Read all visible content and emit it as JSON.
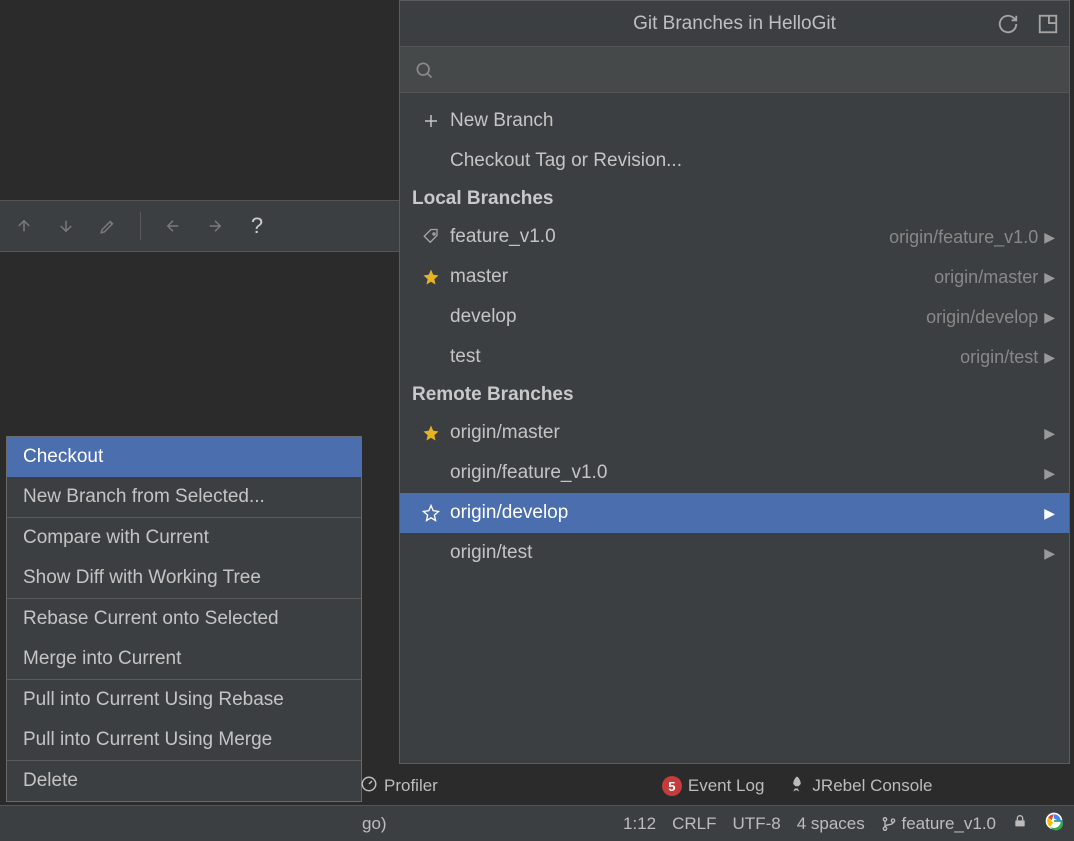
{
  "popup": {
    "title": "Git Branches in HelloGit",
    "new_branch_label": "New Branch",
    "checkout_tag_label": "Checkout Tag or Revision...",
    "local_header": "Local Branches",
    "remote_header": "Remote Branches",
    "local_branches": [
      {
        "name": "feature_v1.0",
        "icon": "tag",
        "tracking": "origin/feature_v1.0"
      },
      {
        "name": "master",
        "icon": "star-filled",
        "tracking": "origin/master"
      },
      {
        "name": "develop",
        "icon": "",
        "tracking": "origin/develop"
      },
      {
        "name": "test",
        "icon": "",
        "tracking": "origin/test"
      }
    ],
    "remote_branches": [
      {
        "name": "origin/master",
        "icon": "star-filled",
        "selected": false
      },
      {
        "name": "origin/feature_v1.0",
        "icon": "",
        "selected": false
      },
      {
        "name": "origin/develop",
        "icon": "star-outline",
        "selected": true
      },
      {
        "name": "origin/test",
        "icon": "",
        "selected": false
      }
    ]
  },
  "context_menu": {
    "items": [
      {
        "label": "Checkout",
        "selected": true
      },
      {
        "label": "New Branch from Selected...",
        "selected": false
      },
      {
        "divider": true
      },
      {
        "label": "Compare with Current",
        "selected": false
      },
      {
        "label": "Show Diff with Working Tree",
        "selected": false
      },
      {
        "divider": true
      },
      {
        "label": "Rebase Current onto Selected",
        "selected": false
      },
      {
        "label": "Merge into Current",
        "selected": false
      },
      {
        "divider": true
      },
      {
        "label": "Pull into Current Using Rebase",
        "selected": false
      },
      {
        "label": "Pull into Current Using Merge",
        "selected": false
      },
      {
        "divider": true
      },
      {
        "label": "Delete",
        "selected": false
      }
    ]
  },
  "toolwindow_bar": {
    "profiler": "Profiler",
    "event_log_count": "5",
    "event_log": "Event Log",
    "jrebel": "JRebel Console"
  },
  "status_bar": {
    "left_fragment": "go)",
    "cursor": "1:12",
    "line_sep": "CRLF",
    "encoding": "UTF-8",
    "indent": "4 spaces",
    "branch": "feature_v1.0"
  }
}
